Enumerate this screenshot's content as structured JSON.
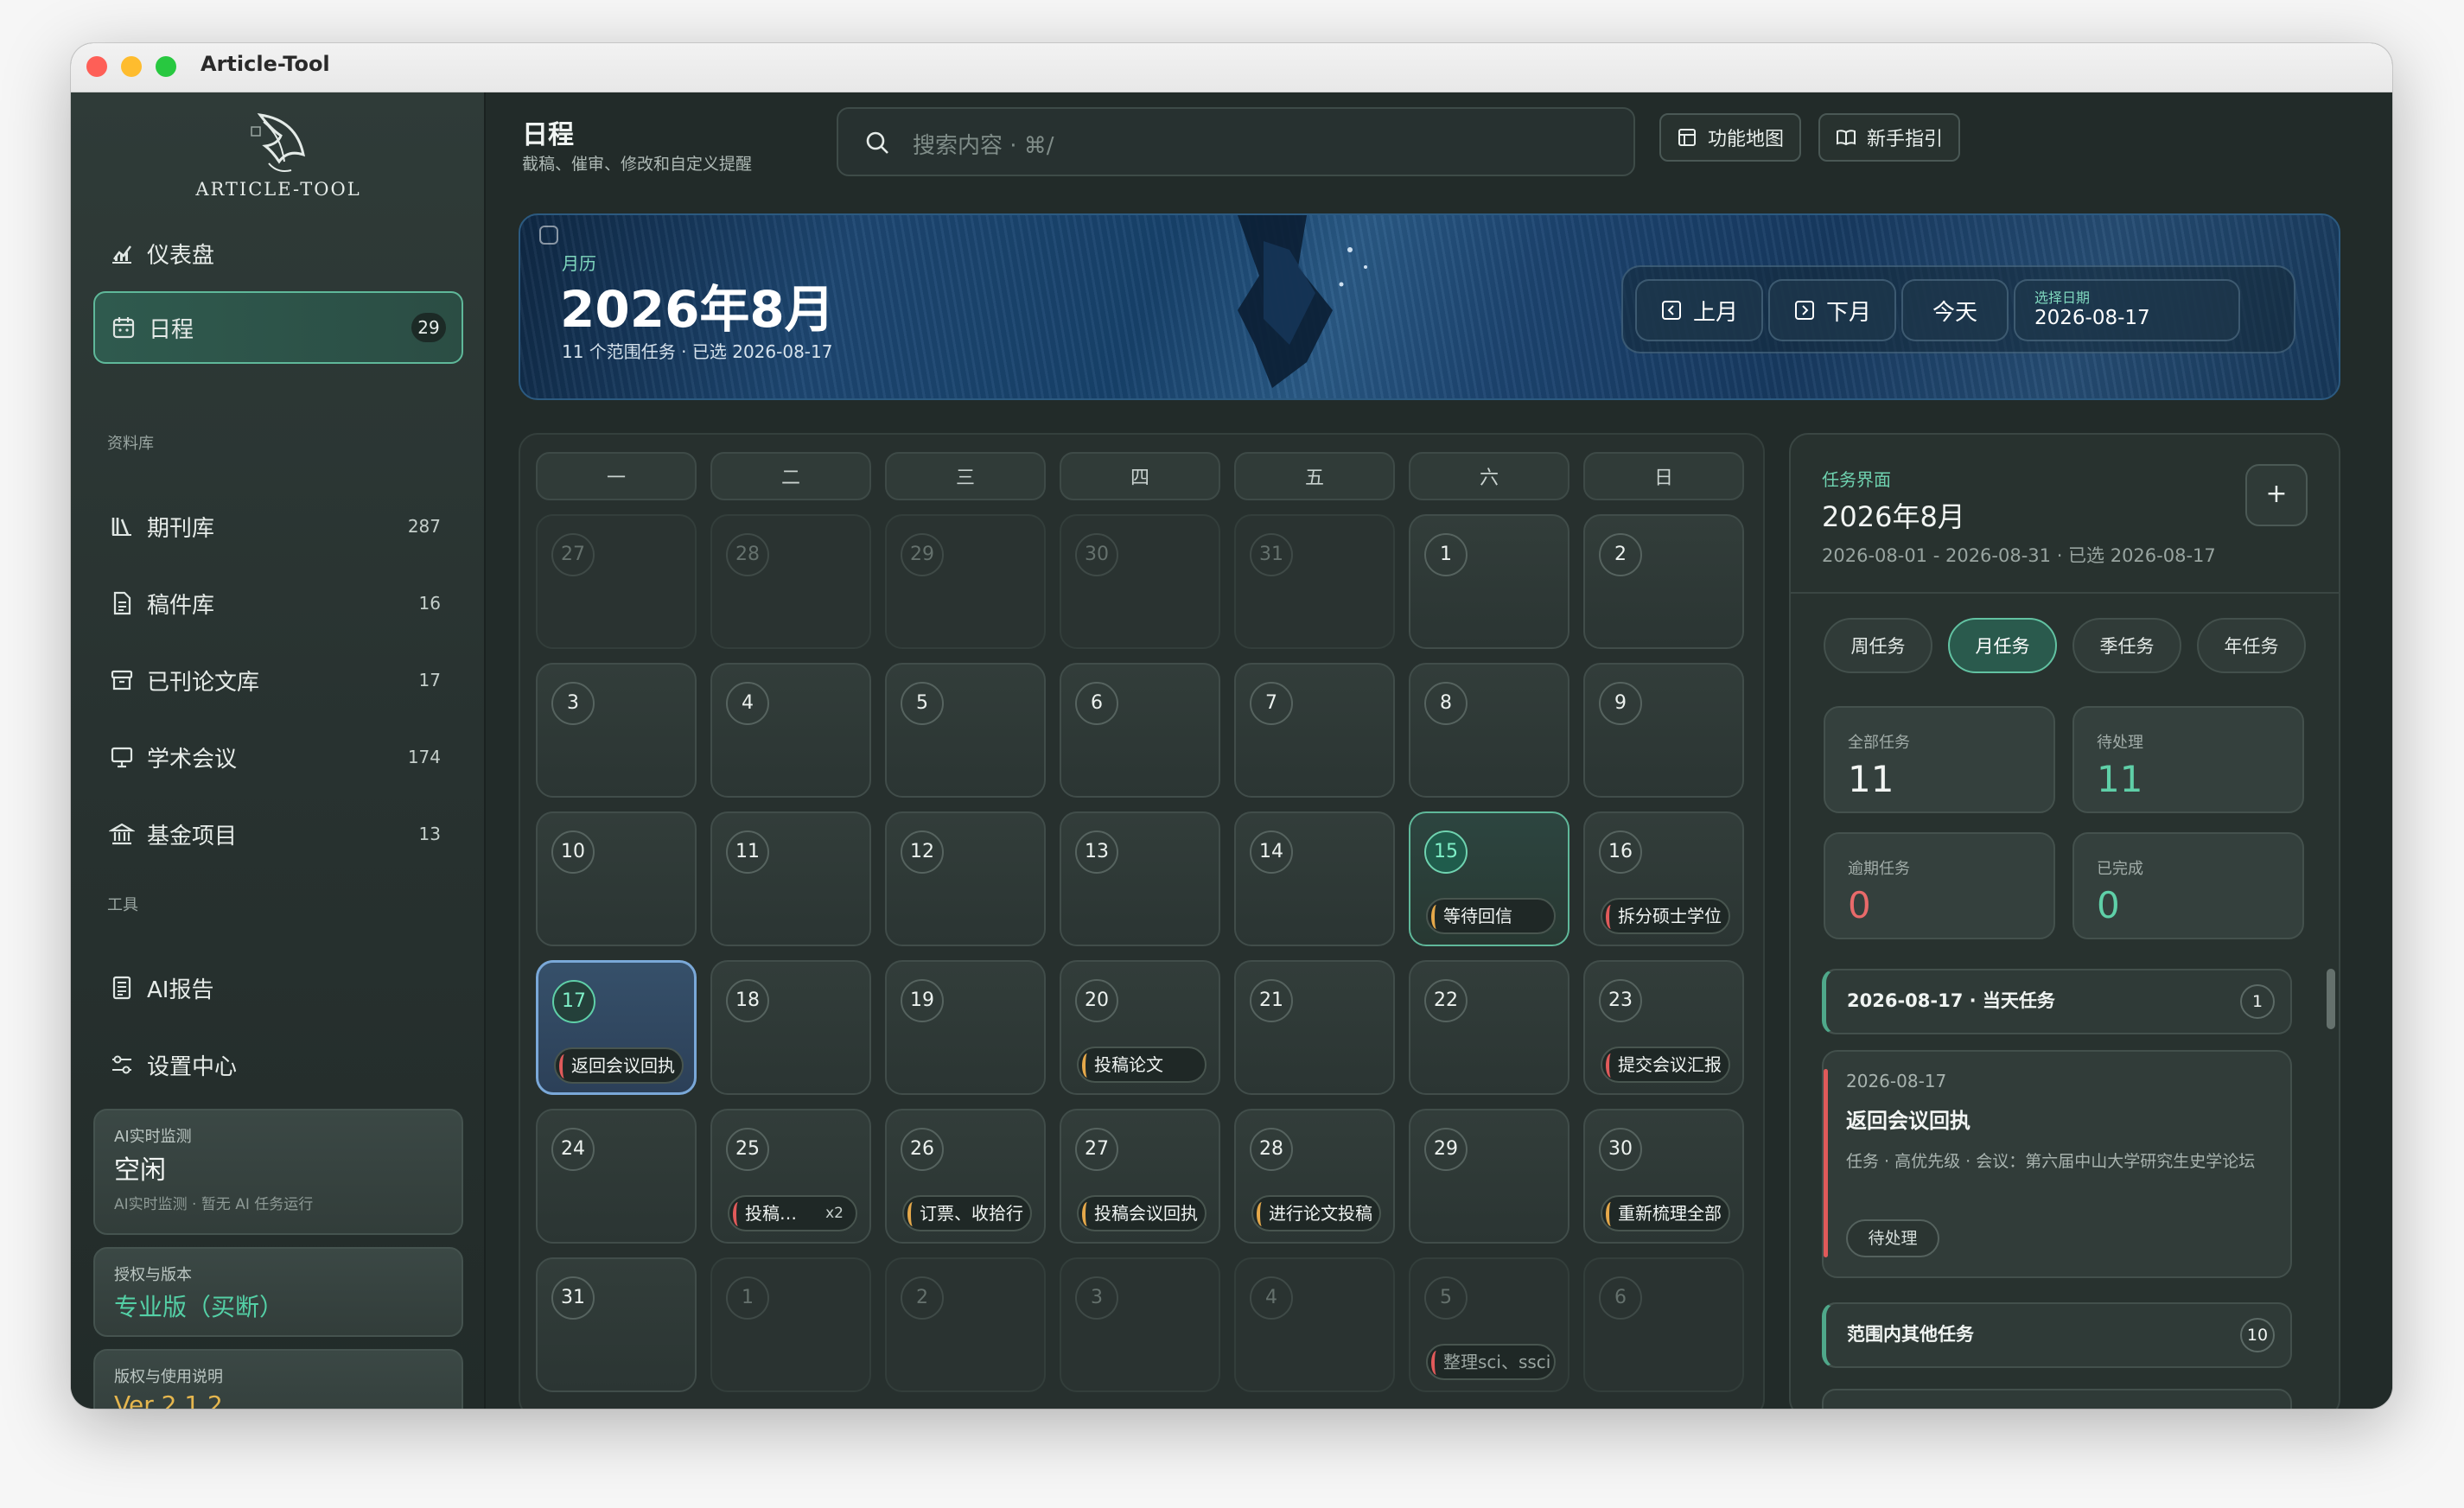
{
  "window": {
    "title": "Article-Tool"
  },
  "sidebar": {
    "logo_text": "ARTICLE-TOOL",
    "nav_top": [
      {
        "label": "仪表盘",
        "icon": "chart-icon"
      },
      {
        "label": "日程",
        "count": "29",
        "icon": "calendar-icon",
        "active": true
      }
    ],
    "library_section": "资料库",
    "library": [
      {
        "label": "期刊库",
        "count": "287",
        "icon": "books-icon"
      },
      {
        "label": "稿件库",
        "count": "16",
        "icon": "document-icon"
      },
      {
        "label": "已刊论文库",
        "count": "17",
        "icon": "archive-icon"
      },
      {
        "label": "学术会议",
        "count": "174",
        "icon": "presentation-icon"
      },
      {
        "label": "基金项目",
        "count": "13",
        "icon": "bank-icon"
      }
    ],
    "tools_section": "工具",
    "tools": [
      {
        "label": "AI报告",
        "icon": "report-icon"
      },
      {
        "label": "设置中心",
        "icon": "settings-icon"
      }
    ],
    "ai_card": {
      "title": "AI实时监测",
      "status": "空闲",
      "desc": "AI实时监测 · 暂无 AI 任务运行"
    },
    "license_card": {
      "title": "授权与版本",
      "value": "专业版（买断）"
    },
    "version_card": {
      "title": "版权与使用说明",
      "value": "Ver 2.1.2"
    }
  },
  "header": {
    "title": "日程",
    "subtitle": "截稿、催审、修改和自定义提醒",
    "search_placeholder": "搜索内容 · ⌘/",
    "btn_map": "功能地图",
    "btn_guide": "新手指引"
  },
  "banner": {
    "label": "月历",
    "month": "2026年8月",
    "meta": "11 个范围任务 · 已选 2026-08-17",
    "prev": "上月",
    "next": "下月",
    "today": "今天",
    "picker_label": "选择日期",
    "picker_value": "2026-08-17"
  },
  "calendar": {
    "weekdays": [
      "一",
      "二",
      "三",
      "四",
      "五",
      "六",
      "日"
    ],
    "cells": [
      {
        "d": "27",
        "dim": true
      },
      {
        "d": "28",
        "dim": true
      },
      {
        "d": "29",
        "dim": true
      },
      {
        "d": "30",
        "dim": true
      },
      {
        "d": "31",
        "dim": true
      },
      {
        "d": "1"
      },
      {
        "d": "2"
      },
      {
        "d": "3"
      },
      {
        "d": "4"
      },
      {
        "d": "5"
      },
      {
        "d": "6"
      },
      {
        "d": "7"
      },
      {
        "d": "8"
      },
      {
        "d": "9"
      },
      {
        "d": "10"
      },
      {
        "d": "11"
      },
      {
        "d": "12"
      },
      {
        "d": "13"
      },
      {
        "d": "14"
      },
      {
        "d": "15",
        "today": true,
        "chip": "等待回信",
        "chip_color": "orange"
      },
      {
        "d": "16",
        "chip": "拆分硕士学位",
        "chip_color": "red"
      },
      {
        "d": "17",
        "selected": true,
        "chip": "返回会议回执",
        "chip_color": "red"
      },
      {
        "d": "18"
      },
      {
        "d": "19"
      },
      {
        "d": "20",
        "chip": "投稿论文",
        "chip_color": "orange"
      },
      {
        "d": "21"
      },
      {
        "d": "22"
      },
      {
        "d": "23",
        "chip": "提交会议汇报",
        "chip_color": "red"
      },
      {
        "d": "24"
      },
      {
        "d": "25",
        "chip": "投稿…",
        "chip_extra": "x2",
        "chip_color": "red"
      },
      {
        "d": "26",
        "chip": "订票、收拾行",
        "chip_color": "orange"
      },
      {
        "d": "27",
        "chip": "投稿会议回执",
        "chip_color": "orange"
      },
      {
        "d": "28",
        "chip": "进行论文投稿",
        "chip_color": "orange"
      },
      {
        "d": "29"
      },
      {
        "d": "30",
        "chip": "重新梳理全部",
        "chip_color": "orange"
      },
      {
        "d": "31"
      },
      {
        "d": "1",
        "dim": true
      },
      {
        "d": "2",
        "dim": true
      },
      {
        "d": "3",
        "dim": true
      },
      {
        "d": "4",
        "dim": true
      },
      {
        "d": "5",
        "dim": true,
        "chip": "整理sci、ssci",
        "chip_color": "red"
      },
      {
        "d": "6",
        "dim": true
      }
    ]
  },
  "task_panel": {
    "label": "任务界面",
    "title": "2026年8月",
    "range": "2026-08-01 - 2026-08-31 · 已选 2026-08-17",
    "add": "+",
    "tabs": [
      "周任务",
      "月任务",
      "季任务",
      "年任务"
    ],
    "active_tab": "月任务",
    "stats": [
      {
        "label": "全部任务",
        "value": "11",
        "color": "#f2f5f3"
      },
      {
        "label": "待处理",
        "value": "11",
        "color": "#5fd0a8"
      },
      {
        "label": "逾期任务",
        "value": "0",
        "color": "#e86a6a"
      },
      {
        "label": "已完成",
        "value": "0",
        "color": "#5fd0a8"
      }
    ],
    "day_group": {
      "title": "2026-08-17 · 当天任务",
      "count": "1"
    },
    "task": {
      "date": "2026-08-17",
      "title": "返回会议回执",
      "desc": "任务 · 高优先级 · 会议：第六届中山大学研究生史学论坛",
      "status": "待处理"
    },
    "other_group": {
      "title": "范围内其他任务",
      "count": "10"
    }
  },
  "colors": {
    "accent": "#5fb89a",
    "bg": "#222b29",
    "danger": "#e05a5a",
    "warn": "#e5a84a"
  }
}
